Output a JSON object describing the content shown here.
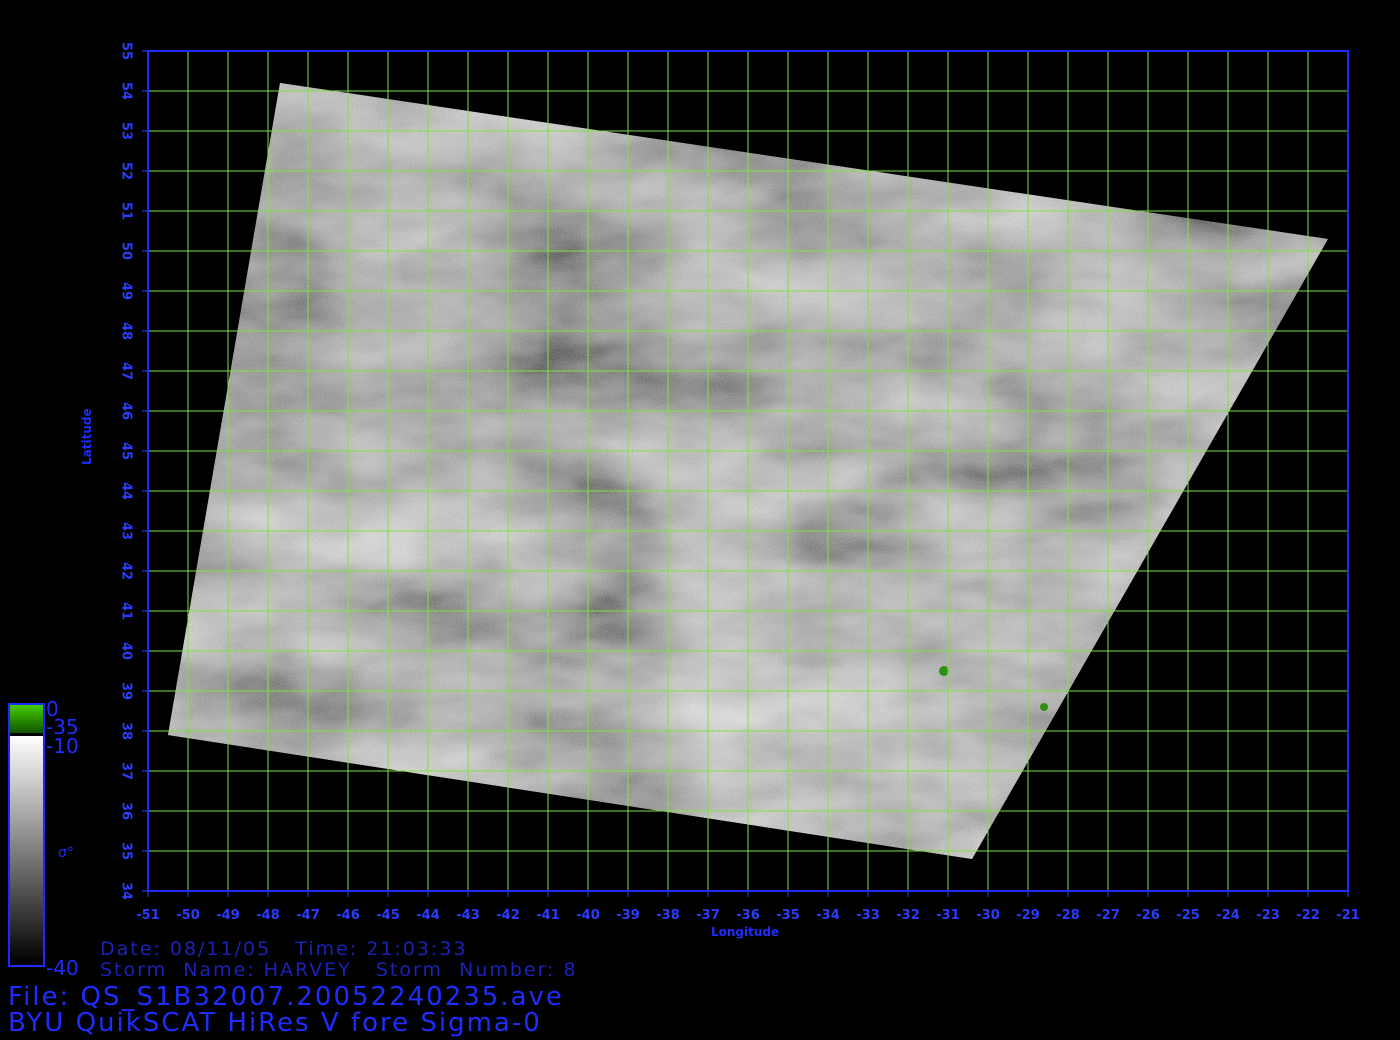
{
  "map": {
    "lon_range": [
      -51,
      -21
    ],
    "lat_range": [
      34,
      55
    ],
    "lon_ticks": [
      "-51",
      "-50",
      "-49",
      "-48",
      "-47",
      "-46",
      "-45",
      "-44",
      "-43",
      "-42",
      "-41",
      "-40",
      "-39",
      "-38",
      "-37",
      "-36",
      "-35",
      "-34",
      "-33",
      "-32",
      "-31",
      "-30",
      "-29",
      "-28",
      "-27",
      "-26",
      "-25",
      "-24",
      "-23",
      "-22",
      "-21"
    ],
    "lat_ticks": [
      "34",
      "35",
      "36",
      "37",
      "38",
      "39",
      "40",
      "41",
      "42",
      "43",
      "44",
      "45",
      "46",
      "47",
      "48",
      "49",
      "50",
      "51",
      "52",
      "53",
      "54",
      "55"
    ],
    "xlabel": "Longitude",
    "ylabel": "Latitude",
    "swath_corners_lonlat": [
      [
        -47.7,
        54.2
      ],
      [
        -21.5,
        50.3
      ],
      [
        -30.4,
        34.8
      ],
      [
        -50.5,
        37.9
      ]
    ],
    "grid_color": "#80e040",
    "axis_color": "#2b3cff",
    "frame_color": "#1a2bff",
    "land_color": "#2f8f10"
  },
  "colorbar": {
    "label": "σ°",
    "top_label": "0",
    "label_m35": "-35",
    "label_m10": "-10",
    "bottom_label": "-40",
    "green_color": "#33aa00",
    "colors": [
      "#ffffff",
      "#000000"
    ]
  },
  "info": {
    "date_line": "Date: 08/11/05   Time: 21:03:33",
    "storm_line": "Storm  Name: HARVEY   Storm  Number: 8",
    "file_line": "File: QS_S1B32007.20052240235.ave",
    "product_line": "BYU QuikSCAT HiRes V fore Sigma-0"
  }
}
